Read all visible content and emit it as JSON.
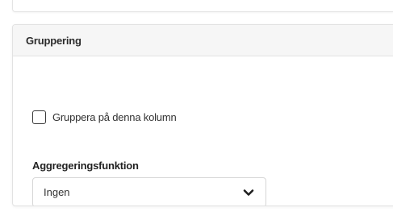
{
  "grouping_panel": {
    "title": "Gruppering",
    "group_checkbox": {
      "label": "Gruppera på denna kolumn",
      "checked": false
    },
    "aggregation": {
      "label": "Aggregeringsfunktion",
      "selected": "Ingen",
      "icon": "chevron-down-icon"
    }
  }
}
